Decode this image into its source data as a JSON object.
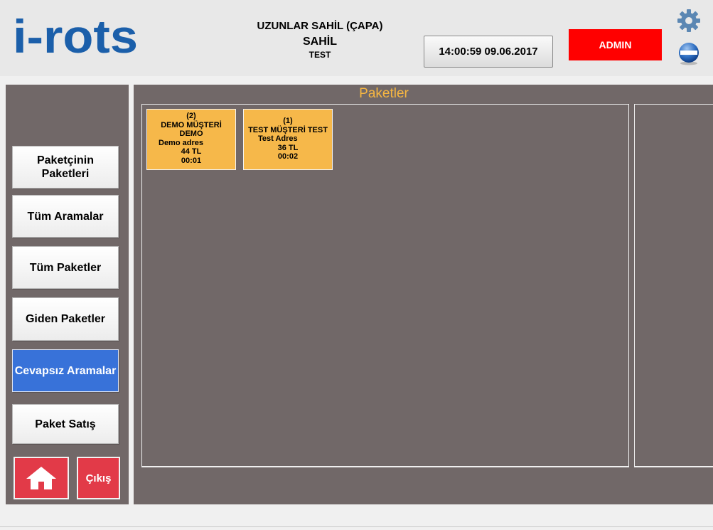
{
  "header": {
    "logo_text": "i-rots",
    "venue_name": "UZUNLAR SAHİL (ÇAPA)",
    "branch_name": "SAHİL",
    "terminal_name": "TEST",
    "clock": "14:00:59 09.06.2017",
    "user_button": "ADMIN"
  },
  "colors": {
    "logo": "#1b5faa",
    "sidebar_bg": "#716868",
    "active_button": "#3872d9",
    "admin_button": "#ff0000",
    "package_card": "#f6b84a",
    "title": "#f6b642",
    "danger_button": "#e23a48"
  },
  "icons": {
    "settings": "gear-icon",
    "minimize": "minimize-icon",
    "home": "home-icon"
  },
  "sidebar": {
    "items": [
      {
        "label": "Paketçinin Paketleri",
        "active": false
      },
      {
        "label": "Tüm Aramalar",
        "active": false
      },
      {
        "label": "Tüm Paketler",
        "active": false
      },
      {
        "label": "Giden Paketler",
        "active": false
      },
      {
        "label": "Cevapsız Aramalar",
        "active": true
      },
      {
        "label": "Paket Satış",
        "active": false
      }
    ],
    "exit_label": "Çıkış"
  },
  "main": {
    "title": "Paketler",
    "packages": [
      {
        "count": "(2)",
        "customer": "DEMO MÜŞTERİ",
        "name": "DEMO",
        "address": "Demo adres",
        "amount": "44 TL",
        "time": "00:01"
      },
      {
        "count": "(1)",
        "customer": "TEST MÜŞTERİ TEST",
        "name": "",
        "address": "Test Adres",
        "amount": "36 TL",
        "time": "00:02"
      }
    ]
  }
}
